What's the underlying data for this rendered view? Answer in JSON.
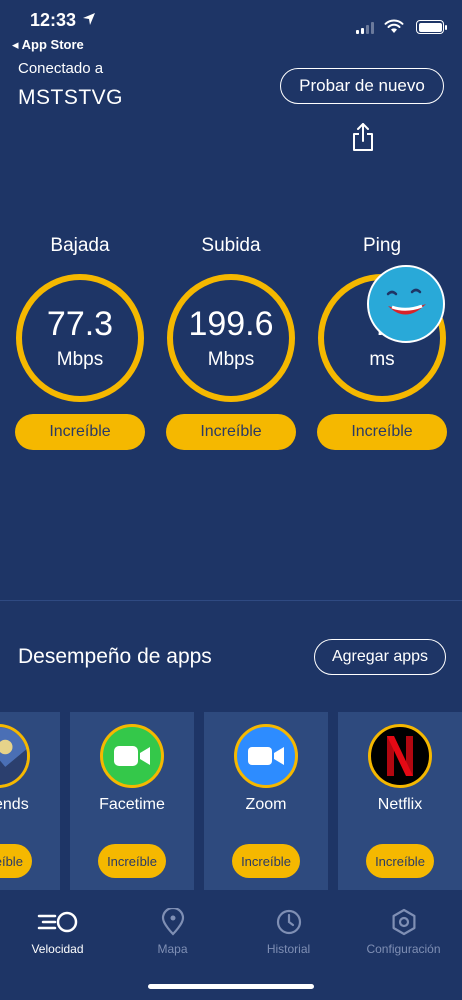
{
  "status_bar": {
    "time": "12:33",
    "back_label": "◂ App Store"
  },
  "header": {
    "connected_label": "Conectado a",
    "network_name": "MSTSTVG",
    "retest_label": "Probar de nuevo"
  },
  "metrics": [
    {
      "title": "Bajada",
      "value": "77.3",
      "unit": "Mbps",
      "rating": "Increíble"
    },
    {
      "title": "Subida",
      "value": "199.6",
      "unit": "Mbps",
      "rating": "Increíble"
    },
    {
      "title": "Ping",
      "value": "7",
      "unit": "ms",
      "rating": "Increíble"
    }
  ],
  "apps_section": {
    "title": "Desempeño de apps",
    "add_label": "Agregar apps",
    "apps": [
      {
        "name": "Legends",
        "rating": "Increíble"
      },
      {
        "name": "Facetime",
        "rating": "Increíble"
      },
      {
        "name": "Zoom",
        "rating": "Increíble"
      },
      {
        "name": "Netflix",
        "rating": "Increíble"
      }
    ]
  },
  "tabs": [
    {
      "label": "Velocidad",
      "icon": "speed-icon",
      "active": true
    },
    {
      "label": "Mapa",
      "icon": "map-pin-icon",
      "active": false
    },
    {
      "label": "Historial",
      "icon": "clock-icon",
      "active": false
    },
    {
      "label": "Configuración",
      "icon": "gear-icon",
      "active": false
    }
  ],
  "colors": {
    "background": "#1e3566",
    "accent": "#f5b800",
    "card": "#2e4a7e",
    "inactive_tab": "#7f8fb4"
  }
}
